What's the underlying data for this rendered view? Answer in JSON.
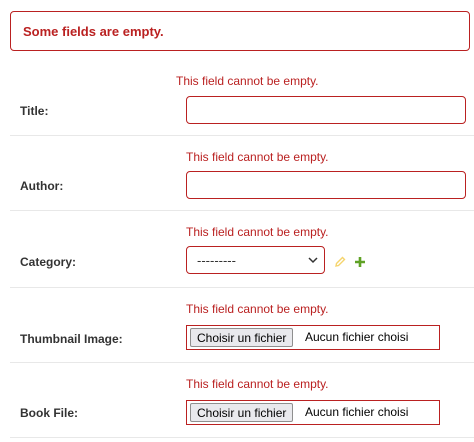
{
  "error_note": "Some fields are empty.",
  "fields": [
    {
      "label": "Title:",
      "error": "This field cannot be empty."
    },
    {
      "label": "Author:",
      "error": "This field cannot be empty."
    },
    {
      "label": "Category:",
      "error": "This field cannot be empty.",
      "selected": "---------"
    },
    {
      "label": "Thumbnail Image:",
      "error": "This field cannot be empty.",
      "button": "Choisir un fichier",
      "status": "Aucun fichier choisi"
    },
    {
      "label": "Book File:",
      "error": "This field cannot be empty.",
      "button": "Choisir un fichier",
      "status": "Aucun fichier choisi"
    }
  ],
  "colors": {
    "error": "#ba2121",
    "add_icon": "#5fa225",
    "edit_icon": "#efb80b"
  },
  "icons": {
    "edit": "pencil-icon",
    "add": "plus-icon",
    "dropdown": "chevron-down-icon"
  }
}
